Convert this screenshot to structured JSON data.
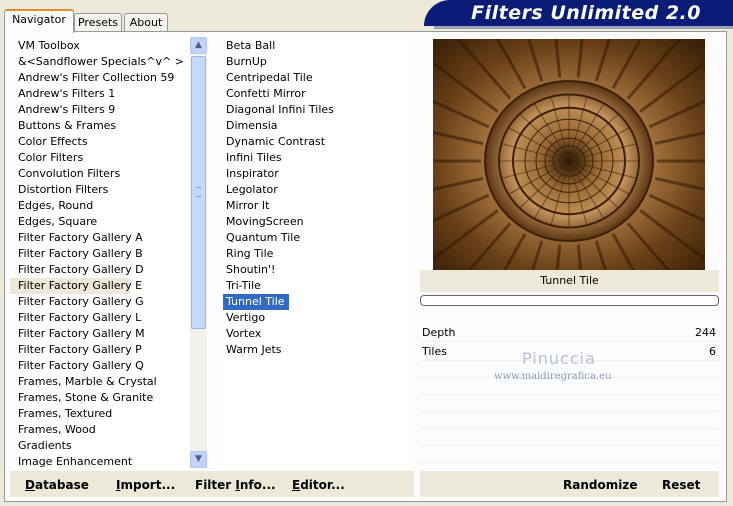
{
  "app": {
    "title": "Filters Unlimited 2.0"
  },
  "tabs": [
    {
      "label": "Navigator",
      "active": true
    },
    {
      "label": "Presets",
      "active": false
    },
    {
      "label": "About",
      "active": false
    }
  ],
  "categories": {
    "selected_index": 15,
    "items": [
      "VM Toolbox",
      "&<Sandflower Specials^v^ >",
      "Andrew's Filter Collection 59",
      "Andrew's Filters 1",
      "Andrew's Filters 9",
      "Buttons & Frames",
      "Color Effects",
      "Color Filters",
      "Convolution Filters",
      "Distortion Filters",
      "Edges, Round",
      "Edges, Square",
      "Filter Factory Gallery A",
      "Filter Factory Gallery B",
      "Filter Factory Gallery D",
      "Filter Factory Gallery E",
      "Filter Factory Gallery G",
      "Filter Factory Gallery L",
      "Filter Factory Gallery M",
      "Filter Factory Gallery P",
      "Filter Factory Gallery Q",
      "Frames, Marble & Crystal",
      "Frames, Stone & Granite",
      "Frames, Textured",
      "Frames, Wood",
      "Gradients",
      "Image Enhancement"
    ]
  },
  "filters": {
    "selected_index": 16,
    "items": [
      "Beta Ball",
      "BurnUp",
      "Centripedal Tile",
      "Confetti Mirror",
      "Diagonal Infini Tiles",
      "Dimensia",
      "Dynamic Contrast",
      "Infini Tiles",
      "Inspirator",
      "Legolator",
      "Mirror It",
      "MovingScreen",
      "Quantum Tile",
      "Ring Tile",
      "Shoutin'!",
      "Tri-Tile",
      "Tunnel Tile",
      "Vertigo",
      "Vortex",
      "Warm Jets"
    ]
  },
  "preview": {
    "filter_name": "Tunnel Tile",
    "progress": 0
  },
  "params": [
    {
      "label": "Depth",
      "value": "244"
    },
    {
      "label": "Tiles",
      "value": "6"
    }
  ],
  "watermark": {
    "line1": "Pinuccia",
    "line2": "www.maidiregrafica.eu"
  },
  "buttons": {
    "database": {
      "u": "D",
      "rest": "atabase"
    },
    "import": {
      "u": "I",
      "rest": "mport..."
    },
    "filter_info": {
      "pre": "Filter ",
      "u": "I",
      "rest": "nfo..."
    },
    "editor": {
      "u": "E",
      "rest": "ditor..."
    },
    "randomize": "Randomize",
    "reset": "Reset"
  },
  "colors": {
    "banner": "#0A1C78",
    "selection": "#316AC5",
    "preview_tone": "#8A5A26"
  }
}
